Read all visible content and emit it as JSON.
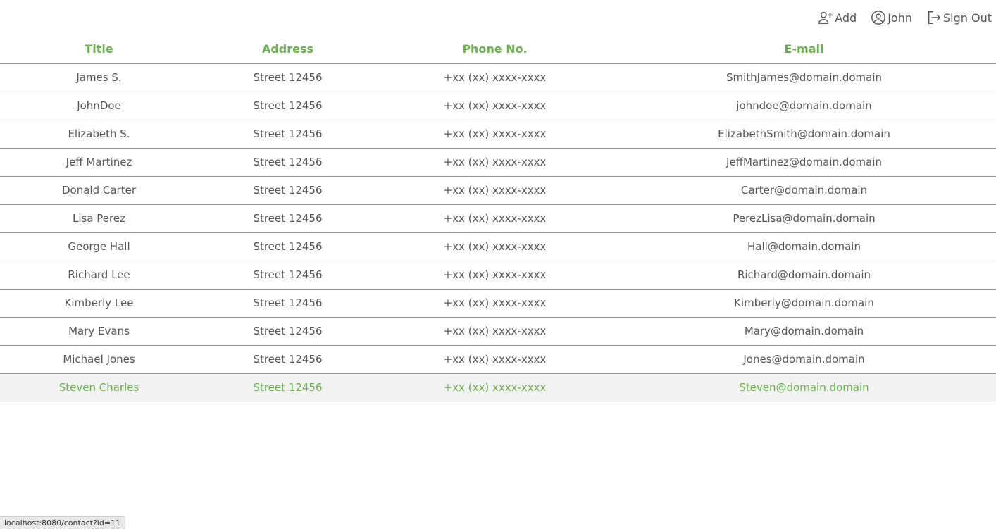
{
  "nav": {
    "add_label": "Add",
    "user_label": "John",
    "signout_label": "Sign Out"
  },
  "table": {
    "headers": {
      "title": "Title",
      "address": "Address",
      "phone": "Phone No.",
      "email": "E-mail"
    },
    "rows": [
      {
        "title": "James S.",
        "address": "Street 12456",
        "phone": "+xx (xx) xxxx-xxxx",
        "email": "SmithJames@domain.domain"
      },
      {
        "title": "JohnDoe",
        "address": "Street 12456",
        "phone": "+xx (xx) xxxx-xxxx",
        "email": "johndoe@domain.domain"
      },
      {
        "title": "Elizabeth S.",
        "address": "Street 12456",
        "phone": "+xx (xx) xxxx-xxxx",
        "email": "ElizabethSmith@domain.domain"
      },
      {
        "title": "Jeff Martinez",
        "address": "Street 12456",
        "phone": "+xx (xx) xxxx-xxxx",
        "email": "JeffMartinez@domain.domain"
      },
      {
        "title": "Donald Carter",
        "address": "Street 12456",
        "phone": "+xx (xx) xxxx-xxxx",
        "email": "Carter@domain.domain"
      },
      {
        "title": "Lisa Perez",
        "address": "Street 12456",
        "phone": "+xx (xx) xxxx-xxxx",
        "email": "PerezLisa@domain.domain"
      },
      {
        "title": "George Hall",
        "address": "Street 12456",
        "phone": "+xx (xx) xxxx-xxxx",
        "email": "Hall@domain.domain"
      },
      {
        "title": "Richard Lee",
        "address": "Street 12456",
        "phone": "+xx (xx) xxxx-xxxx",
        "email": "Richard@domain.domain"
      },
      {
        "title": "Kimberly Lee",
        "address": "Street 12456",
        "phone": "+xx (xx) xxxx-xxxx",
        "email": "Kimberly@domain.domain"
      },
      {
        "title": "Mary Evans",
        "address": "Street 12456",
        "phone": "+xx (xx) xxxx-xxxx",
        "email": "Mary@domain.domain"
      },
      {
        "title": "Michael Jones",
        "address": "Street 12456",
        "phone": "+xx (xx) xxxx-xxxx",
        "email": "Jones@domain.domain"
      },
      {
        "title": "Steven Charles",
        "address": "Street 12456",
        "phone": "+xx (xx) xxxx-xxxx",
        "email": "Steven@domain.domain",
        "hovered": true
      }
    ]
  },
  "status_bar": {
    "url": "localhost:8080/contact?id=11"
  },
  "colors": {
    "accent": "#6ab04c",
    "text": "#555555",
    "row_hover_bg": "#f2f2f2",
    "divider": "#9a9a9a"
  }
}
